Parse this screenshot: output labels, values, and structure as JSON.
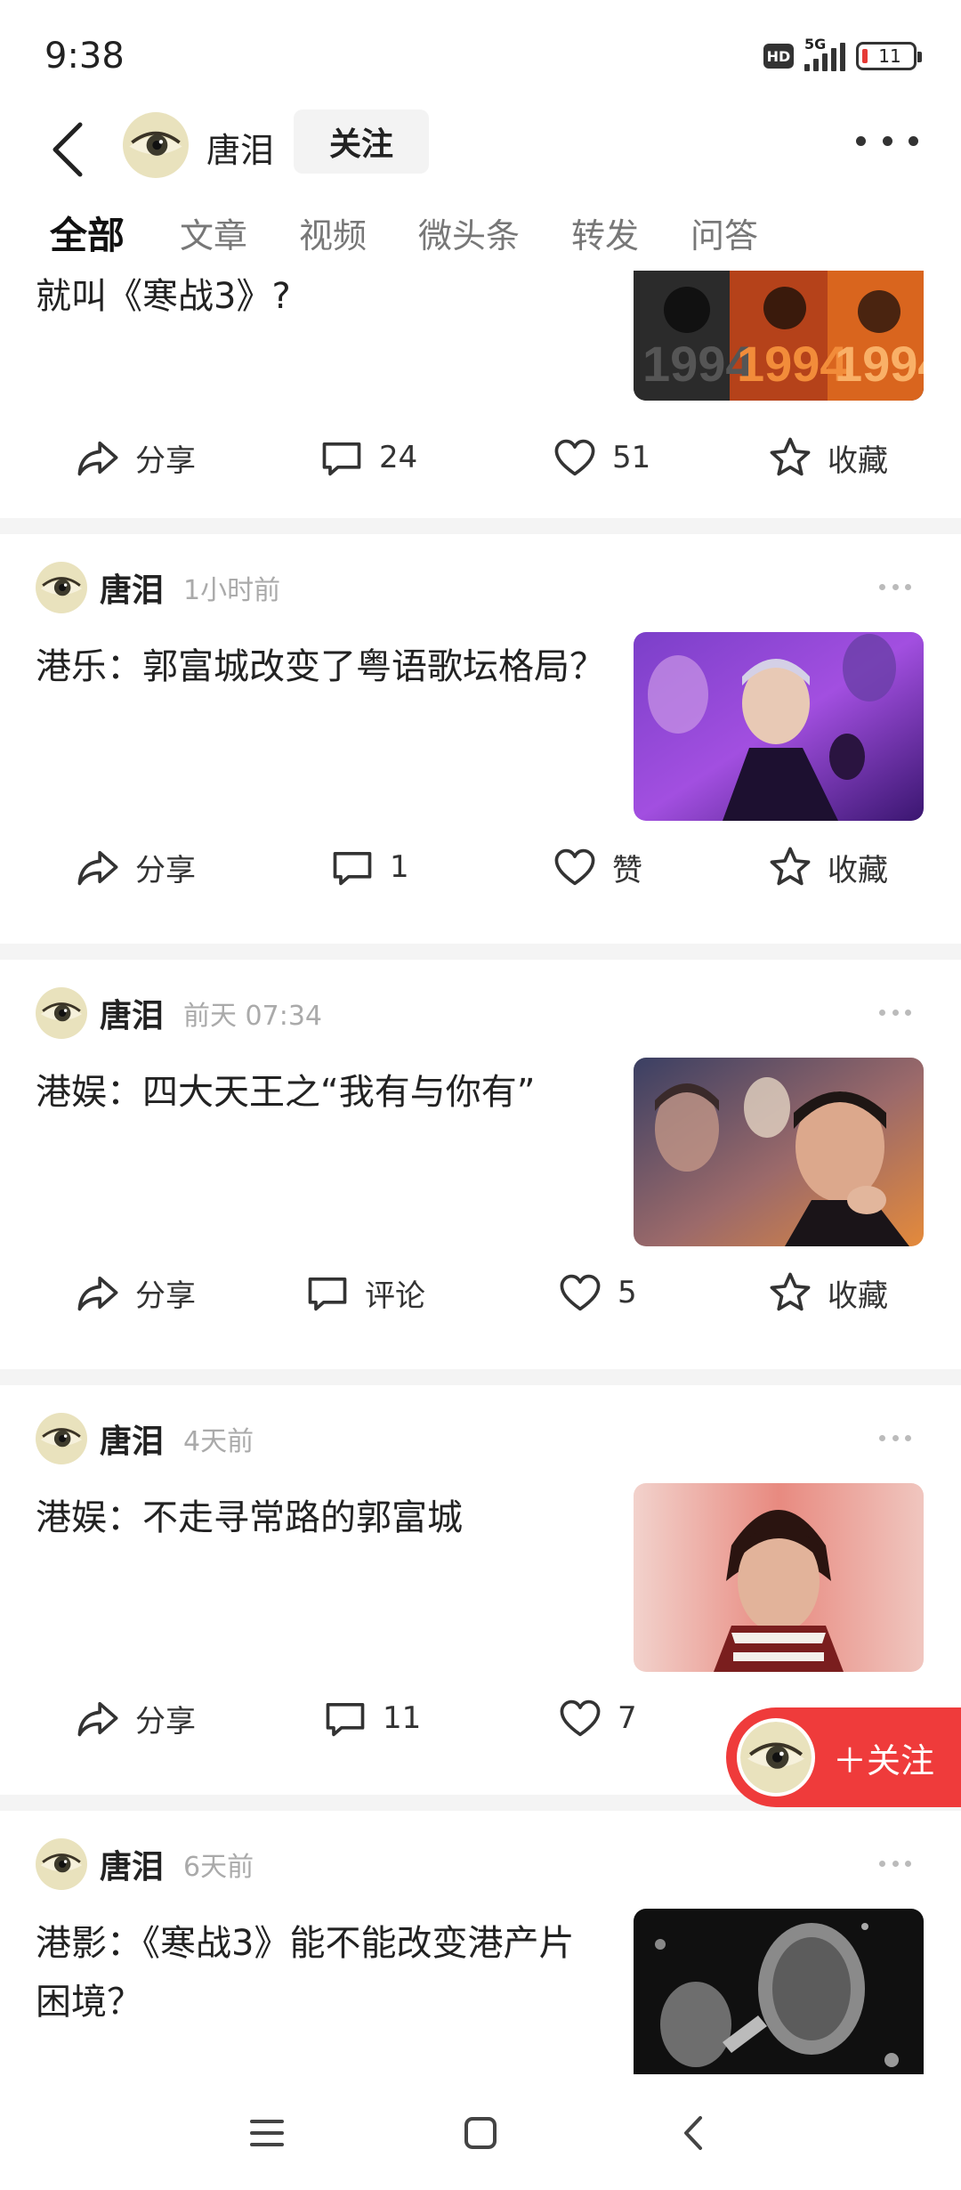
{
  "status": {
    "time": "9:38",
    "hd": "HD",
    "network": "5G",
    "battery": "11"
  },
  "header": {
    "name": "唐泪",
    "follow_label": "关注"
  },
  "tabs": [
    "全部",
    "文章",
    "视频",
    "微头条",
    "转发",
    "问答"
  ],
  "first_card": {
    "title": "就叫《寒战3》?",
    "actions": {
      "share": "分享",
      "comment": "24",
      "like": "51",
      "collect": "收藏"
    }
  },
  "posts": [
    {
      "author": "唐泪",
      "time": "1小时前",
      "title": "港乐：郭富城改变了粤语歌坛格局？",
      "actions": {
        "share": "分享",
        "comment": "1",
        "like": "赞",
        "collect": "收藏"
      }
    },
    {
      "author": "唐泪",
      "time": "前天  07:34",
      "title": "港娱：四大天王之“我有与你有”",
      "actions": {
        "share": "分享",
        "comment": "评论",
        "like": "5",
        "collect": "收藏"
      }
    },
    {
      "author": "唐泪",
      "time": "4天前",
      "title": "港娱：不走寻常路的郭富城",
      "actions": {
        "share": "分享",
        "comment": "11",
        "like": "7"
      }
    },
    {
      "author": "唐泪",
      "time": "6天前",
      "title": "港影：《寒战3》能不能改变港产片困境？"
    }
  ],
  "float_follow": {
    "label": "＋关注"
  },
  "colors": {
    "accent_red": "#ef3b3b",
    "divider": "#f4f4f4",
    "muted": "#aaaaaa"
  },
  "icons": [
    "back-icon",
    "avatar-eye-icon",
    "more-icon",
    "share-icon",
    "comment-icon",
    "like-icon",
    "collect-icon",
    "menu-icon",
    "home-icon",
    "nav-back-icon"
  ]
}
